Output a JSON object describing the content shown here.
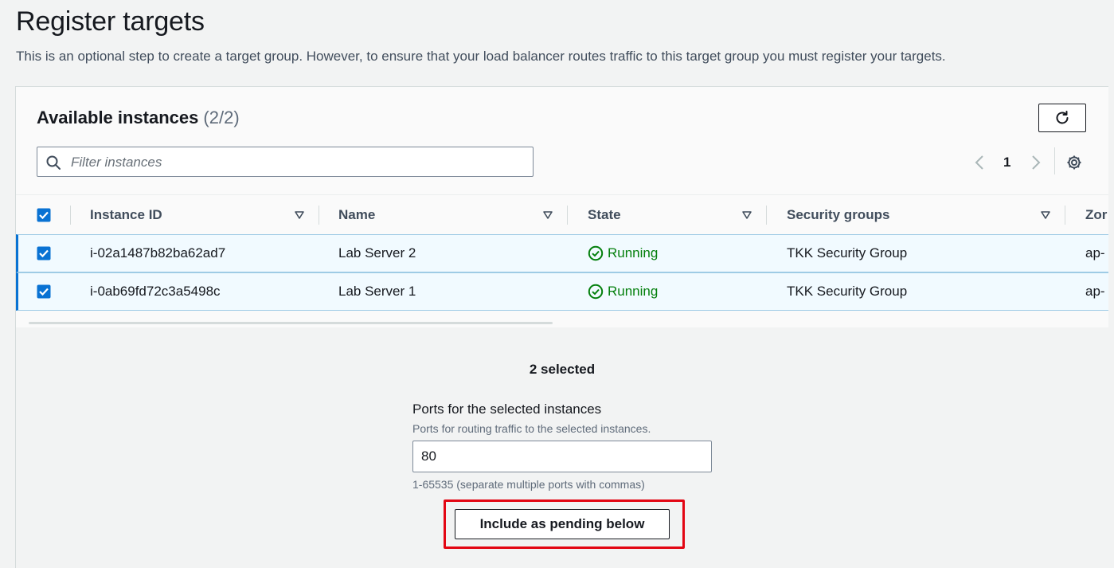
{
  "page": {
    "title": "Register targets",
    "description": "This is an optional step to create a target group. However, to ensure that your load balancer routes traffic to this target group you must register your targets."
  },
  "instances_panel": {
    "title": "Available instances",
    "count": "(2/2)",
    "filter_placeholder": "Filter instances",
    "page_number": "1",
    "columns": [
      "Instance ID",
      "Name",
      "State",
      "Security groups",
      "Zor"
    ],
    "rows": [
      {
        "instance_id": "i-02a1487b82ba62ad7",
        "name": "Lab Server 2",
        "state": "Running",
        "security_group": "TKK Security Group",
        "zone": "ap-",
        "selected": true
      },
      {
        "instance_id": "i-0ab69fd72c3a5498c",
        "name": "Lab Server 1",
        "state": "Running",
        "security_group": "TKK Security Group",
        "zone": "ap-",
        "selected": true
      }
    ]
  },
  "selection": {
    "selected_count": "2 selected",
    "ports_label": "Ports for the selected instances",
    "ports_description": "Ports for routing traffic to the selected instances.",
    "ports_value": "80",
    "ports_hint": "1-65535 (separate multiple ports with commas)",
    "include_button": "Include as pending below"
  },
  "colors": {
    "accent": "#0972d3",
    "success": "#037f0c",
    "highlight": "#e30613"
  }
}
